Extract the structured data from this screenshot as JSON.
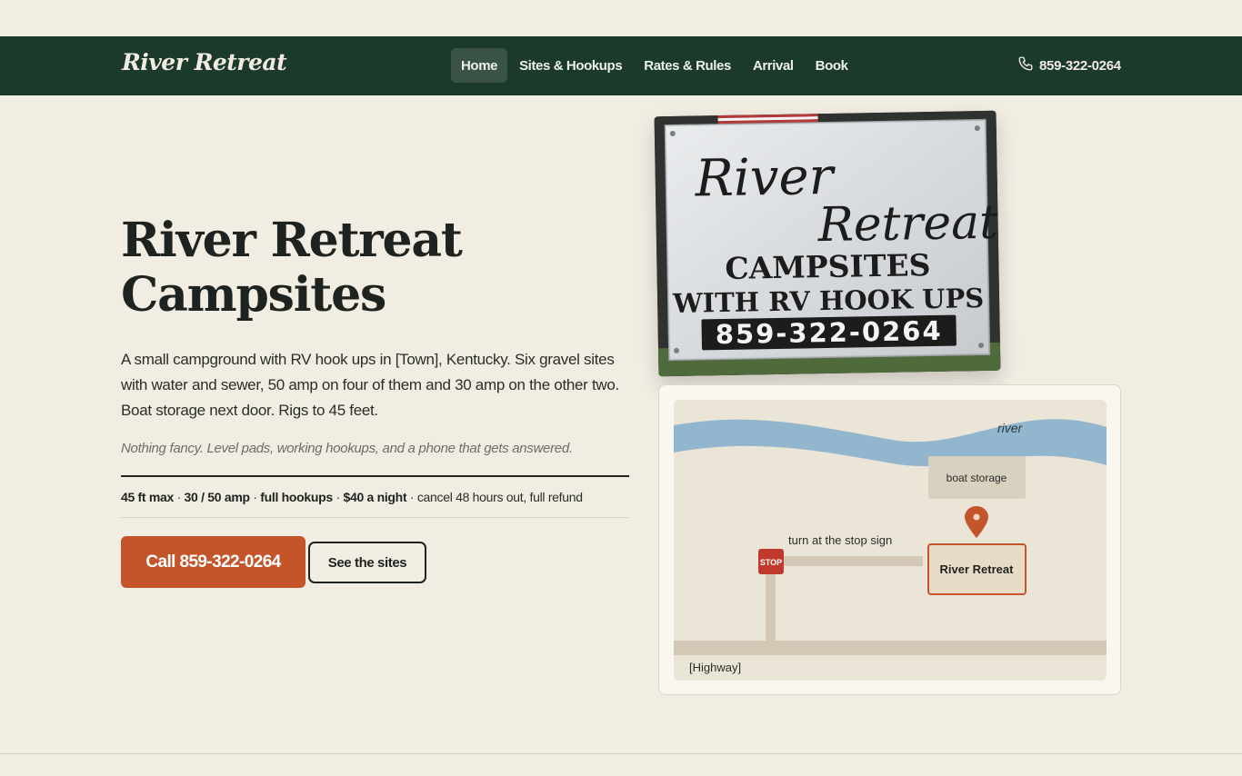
{
  "brand": "River Retreat",
  "nav": {
    "items": [
      {
        "label": "Home",
        "active": true
      },
      {
        "label": "Sites & Hookups",
        "active": false
      },
      {
        "label": "Rates & Rules",
        "active": false
      },
      {
        "label": "Arrival",
        "active": false
      },
      {
        "label": "Book",
        "active": false
      }
    ],
    "phone": "859-322-0264",
    "phone_icon": "phone-icon"
  },
  "hero": {
    "title_line1": "River Retreat",
    "title_line2": "Campsites",
    "lede": "A small campground with RV hook ups in [Town], Kentucky. Six gravel sites with water and sewer, 50 amp on four of them and 30 amp on the other two. Boat storage next door. Rigs to 45 feet.",
    "aside": "Nothing fancy. Level pads, working hookups, and a phone that gets answered.",
    "facts": {
      "max": "45 ft max",
      "amp": "30 / 50 amp",
      "hookups": "full hookups",
      "price": "$40 a night",
      "cancel": "cancel 48 hours out, full refund",
      "sep": " · "
    },
    "call_button": "Call 859-322-0264",
    "sites_button": "See the sites"
  },
  "sign_photo": {
    "line1": "River",
    "line2": "Retreat",
    "line3": "CAMPSITES",
    "line4": "WITH RV HOOK UPS",
    "phone": "859-322-0264"
  },
  "map": {
    "river_label": "river",
    "boat_storage": "boat storage",
    "turn_note": "turn at the stop sign",
    "stop": "STOP",
    "destination": "River Retreat",
    "highway": "[Highway]",
    "colors": {
      "river": "#93b6cf",
      "road": "#d2c8b5",
      "pin": "#c4552b",
      "stop": "#c0392b"
    }
  },
  "colors": {
    "nav_bg": "#1c3a2c",
    "accent": "#c4552b",
    "page_bg": "#f2ede3"
  }
}
